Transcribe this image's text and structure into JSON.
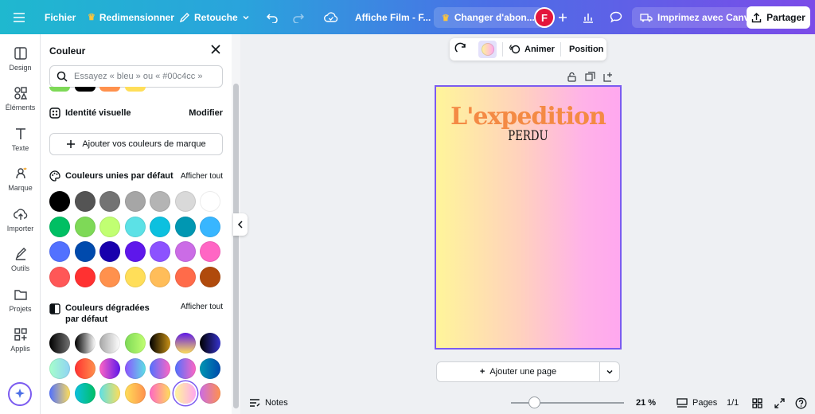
{
  "topbar": {
    "file_label": "Fichier",
    "resize_label": "Redimensionner",
    "retouch_label": "Retouche",
    "doc_title": "Affiche  Film - F...",
    "upgrade_label": "Changer d'abon...",
    "avatar_initial": "F",
    "print_label": "Imprimez avec Canva",
    "share_label": "Partager"
  },
  "rail": {
    "items": [
      {
        "label": "Design"
      },
      {
        "label": "Éléments"
      },
      {
        "label": "Texte"
      },
      {
        "label": "Marque"
      },
      {
        "label": "Importer"
      },
      {
        "label": "Outils"
      },
      {
        "label": "Projets"
      },
      {
        "label": "Applis"
      }
    ]
  },
  "panel": {
    "title": "Couleur",
    "search_placeholder": "Essayez « bleu » ou « #00c4cc »",
    "brand_kit_label": "Identité visuelle",
    "brand_kit_action": "Modifier",
    "add_brand_label": "Ajouter vos couleurs de marque",
    "solid_title": "Couleurs unies par défaut",
    "solid_action": "Afficher tout",
    "gradient_title": "Couleurs dégradées par défaut",
    "gradient_action": "Afficher tout",
    "solid_colors": [
      "#000000",
      "#545454",
      "#737373",
      "#a6a6a6",
      "#b4b4b4",
      "#d9d9d9",
      "#ffffff",
      "#00bf63",
      "#7ed957",
      "#c1ff72",
      "#5ce1e6",
      "#0cc0df",
      "#0097b2",
      "#38b6ff",
      "#5271ff",
      "#004aad",
      "#1800ad",
      "#5e17eb",
      "#8c52ff",
      "#cb6ce6",
      "#ff66c4",
      "#ff5757",
      "#ff3131",
      "#ff914d",
      "#ffde59",
      "#ffbd59",
      "#ff6b4a",
      "#b04a0c"
    ],
    "gradient_colors": [
      "linear-gradient(90deg,#000000,#737373)",
      "linear-gradient(90deg,#000000,#ffffff)",
      "linear-gradient(90deg,#a6a6a6,#ffffff)",
      "linear-gradient(90deg,#7ed957,#c1ff72)",
      "linear-gradient(90deg,#000000,#c89116)",
      "linear-gradient(180deg,#5e17eb,#ffde59)",
      "linear-gradient(90deg,#000000,#3533cd)",
      "linear-gradient(90deg,#a6ffcb,#8fd3f4)",
      "linear-gradient(90deg,#ff3131,#ff914d)",
      "linear-gradient(90deg,#ff66c4,#5e17eb)",
      "linear-gradient(90deg,#8c52ff,#5ce1e6)",
      "linear-gradient(90deg,#5170ff,#ff66c4)",
      "linear-gradient(90deg,#5170ff,#ff66c4)",
      "linear-gradient(90deg,#0097b2,#004aad)",
      "linear-gradient(90deg,#5170ff,#ffde59)",
      "linear-gradient(90deg,#0cc0df,#00bf63)",
      "linear-gradient(90deg,#5ce1e6,#ffde59)",
      "linear-gradient(90deg,#ffde59,#ff914d)",
      "linear-gradient(90deg,#ff66c4,#ffde59)",
      "linear-gradient(90deg,#fff59a,#ffa8ef)",
      "linear-gradient(90deg,#cb6ce6,#ff914d)"
    ],
    "selected_gradient_index": 19,
    "peek_colors": [
      "#7ed957",
      "#000000",
      "#ff914d",
      "#ffde59"
    ]
  },
  "float_toolbar": {
    "animate_label": "Animer",
    "position_label": "Position"
  },
  "poster": {
    "title": "L'expedition",
    "subtitle": "PERDU"
  },
  "add_page_label": "Ajouter une page",
  "bottombar": {
    "notes_label": "Notes",
    "zoom_label": "21 %",
    "pages_label": "Pages",
    "page_count": "1/1"
  },
  "colors": {
    "accent": "#7b5bf0"
  }
}
